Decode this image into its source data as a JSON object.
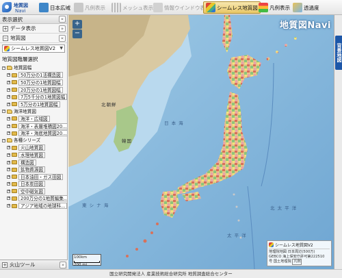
{
  "logo": {
    "line1": "地質図",
    "line2": "Navi"
  },
  "toolbar": [
    {
      "label": "日本広域",
      "icon": "japan-map-icon",
      "state": "normal"
    },
    {
      "label": "凡例表示",
      "icon": "legend-marker-icon",
      "state": "disabled"
    },
    {
      "label": "メッシュ表示",
      "icon": "mesh-grid-icon",
      "state": "disabled"
    },
    {
      "label": "情報ウインドウ表示",
      "icon": "info-window-icon",
      "state": "disabled"
    },
    {
      "label": "シームレス地質図",
      "icon": "seamless-geology-icon",
      "state": "active"
    },
    {
      "label": "凡例表示",
      "icon": "legend-icon",
      "state": "normal"
    },
    {
      "label": "透過度",
      "icon": "transparency-icon",
      "state": "normal"
    }
  ],
  "panel": {
    "header": "表示選択",
    "data_display": "データ表示",
    "basemap": "地質図",
    "selected_map": "シームレス地質図V2",
    "tree_title": "地質図階層選択",
    "tree": [
      {
        "label": "地質図幅",
        "level": 1
      },
      {
        "label": "50万分の1活構造図",
        "level": 2
      },
      {
        "label": "50万分の1地質図幅",
        "level": 2
      },
      {
        "label": "20万分の1地質図幅",
        "level": 2
      },
      {
        "label": "7万5千分の1地質図幅",
        "level": 2
      },
      {
        "label": "5万分の1地質図幅",
        "level": 2
      },
      {
        "label": "海洋地質図",
        "level": 1
      },
      {
        "label": "海洋・広域図",
        "level": 2
      },
      {
        "label": "海洋・表層堆積図20...",
        "level": 2
      },
      {
        "label": "海洋・海底地質図20...",
        "level": 2
      },
      {
        "label": "各種シリーズ",
        "level": 1
      },
      {
        "label": "火山地質図",
        "level": 2
      },
      {
        "label": "水理地質図",
        "level": 2
      },
      {
        "label": "構造図",
        "level": 2
      },
      {
        "label": "鉱物資源図",
        "level": 2
      },
      {
        "label": "日本油田・ガス田図",
        "level": 2
      },
      {
        "label": "日本炭田図",
        "level": 2
      },
      {
        "label": "空中磁気図",
        "level": 2
      },
      {
        "label": "200万分の1地質編集...",
        "level": 2
      },
      {
        "label": "アジア地域の地球科...",
        "level": 2
      }
    ],
    "volcano_tool": "火山ツール"
  },
  "map": {
    "title": "地質図Navi",
    "zoom_in": "+",
    "zoom_out": "−",
    "labels": [
      {
        "text": "日 本 海",
        "kind": "sea"
      },
      {
        "text": "東 シ ナ 海",
        "kind": "sea"
      },
      {
        "text": "北 太 平 洋",
        "kind": "sea"
      },
      {
        "text": "太 平 洋",
        "kind": "sea"
      },
      {
        "text": "北朝鮮",
        "kind": "land"
      },
      {
        "text": "韓国",
        "kind": "land"
      }
    ],
    "scale": {
      "top": "100km",
      "bottom": "200 mi"
    },
    "credit": {
      "layer_name": "シームレス地質図V2",
      "text": "地理院地図 日本周辺(500万)\nGEBCO 海上保安庁許可第222510\n号 国土地理院",
      "button": "凡例"
    }
  },
  "right_tab": "背景地図",
  "footer": "国立研究開発法人 産業技術総合研究所  地質調査総合センター"
}
